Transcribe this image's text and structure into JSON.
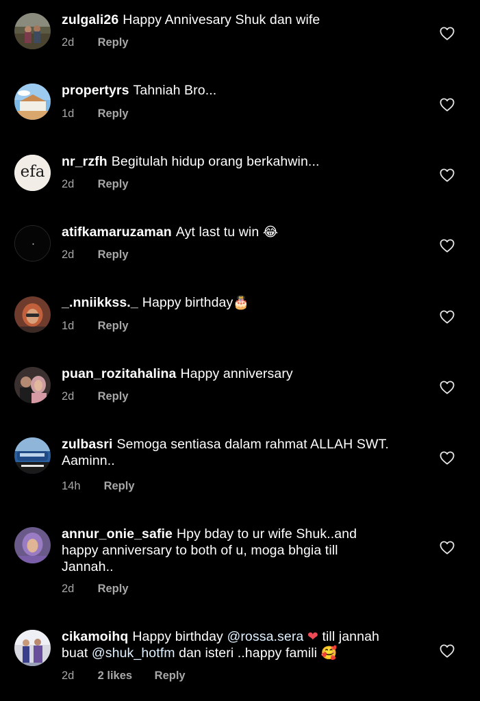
{
  "comments": [
    {
      "username": "zulgali26",
      "text": "Happy Annivesary Shuk dan wife",
      "time": "2d",
      "likes": "",
      "reply_label": "Reply"
    },
    {
      "username": "propertyrs",
      "text": "Tahniah Bro...",
      "time": "1d",
      "likes": "",
      "reply_label": "Reply"
    },
    {
      "username": "nr_rzfh",
      "text": "Begitulah hidup orang berkahwin...",
      "time": "2d",
      "likes": "",
      "reply_label": "Reply",
      "avatar_text": "efa"
    },
    {
      "username": "atifkamaruzaman",
      "text": "Ayt last tu win",
      "emoji": "😂",
      "time": "2d",
      "likes": "",
      "reply_label": "Reply"
    },
    {
      "username": "_.nniikkss._",
      "text": "Happy birthday",
      "emoji": "🎂",
      "time": "1d",
      "likes": "",
      "reply_label": "Reply"
    },
    {
      "username": "puan_rozitahalina",
      "text": "Happy anniversary",
      "time": "2d",
      "likes": "",
      "reply_label": "Reply"
    },
    {
      "username": "zulbasri",
      "text": "Semoga sentiasa dalam rahmat ALLAH SWT.",
      "text_line2": "Aaminn..",
      "time": "14h",
      "likes": "",
      "reply_label": "Reply"
    },
    {
      "username": "annur_onie_safie",
      "text": "Hpy bday to ur wife Shuk..and",
      "text_line2": "happy anniversary to both of u, moga bhgia till",
      "text_line3": "Jannah..",
      "time": "2d",
      "likes": "",
      "reply_label": "Reply"
    },
    {
      "username": "cikamoihq",
      "text": "Happy birthday",
      "mention1": "@rossa.sera",
      "heart_emoji": "❤️",
      "text_after": "till jannah",
      "line2_mention": "@shuk_hotfm",
      "line2_before": "buat",
      "line2_text": "dan isteri ..happy famili",
      "emoji": "🥰",
      "time": "2d",
      "likes": "2 likes",
      "reply_label": "Reply"
    }
  ],
  "colors": {
    "background": "#000000",
    "text": "#ffffff",
    "meta": "#a8a8a8",
    "heart_red": "#ed4956"
  },
  "icons": {
    "like": "heart-outline-icon"
  }
}
